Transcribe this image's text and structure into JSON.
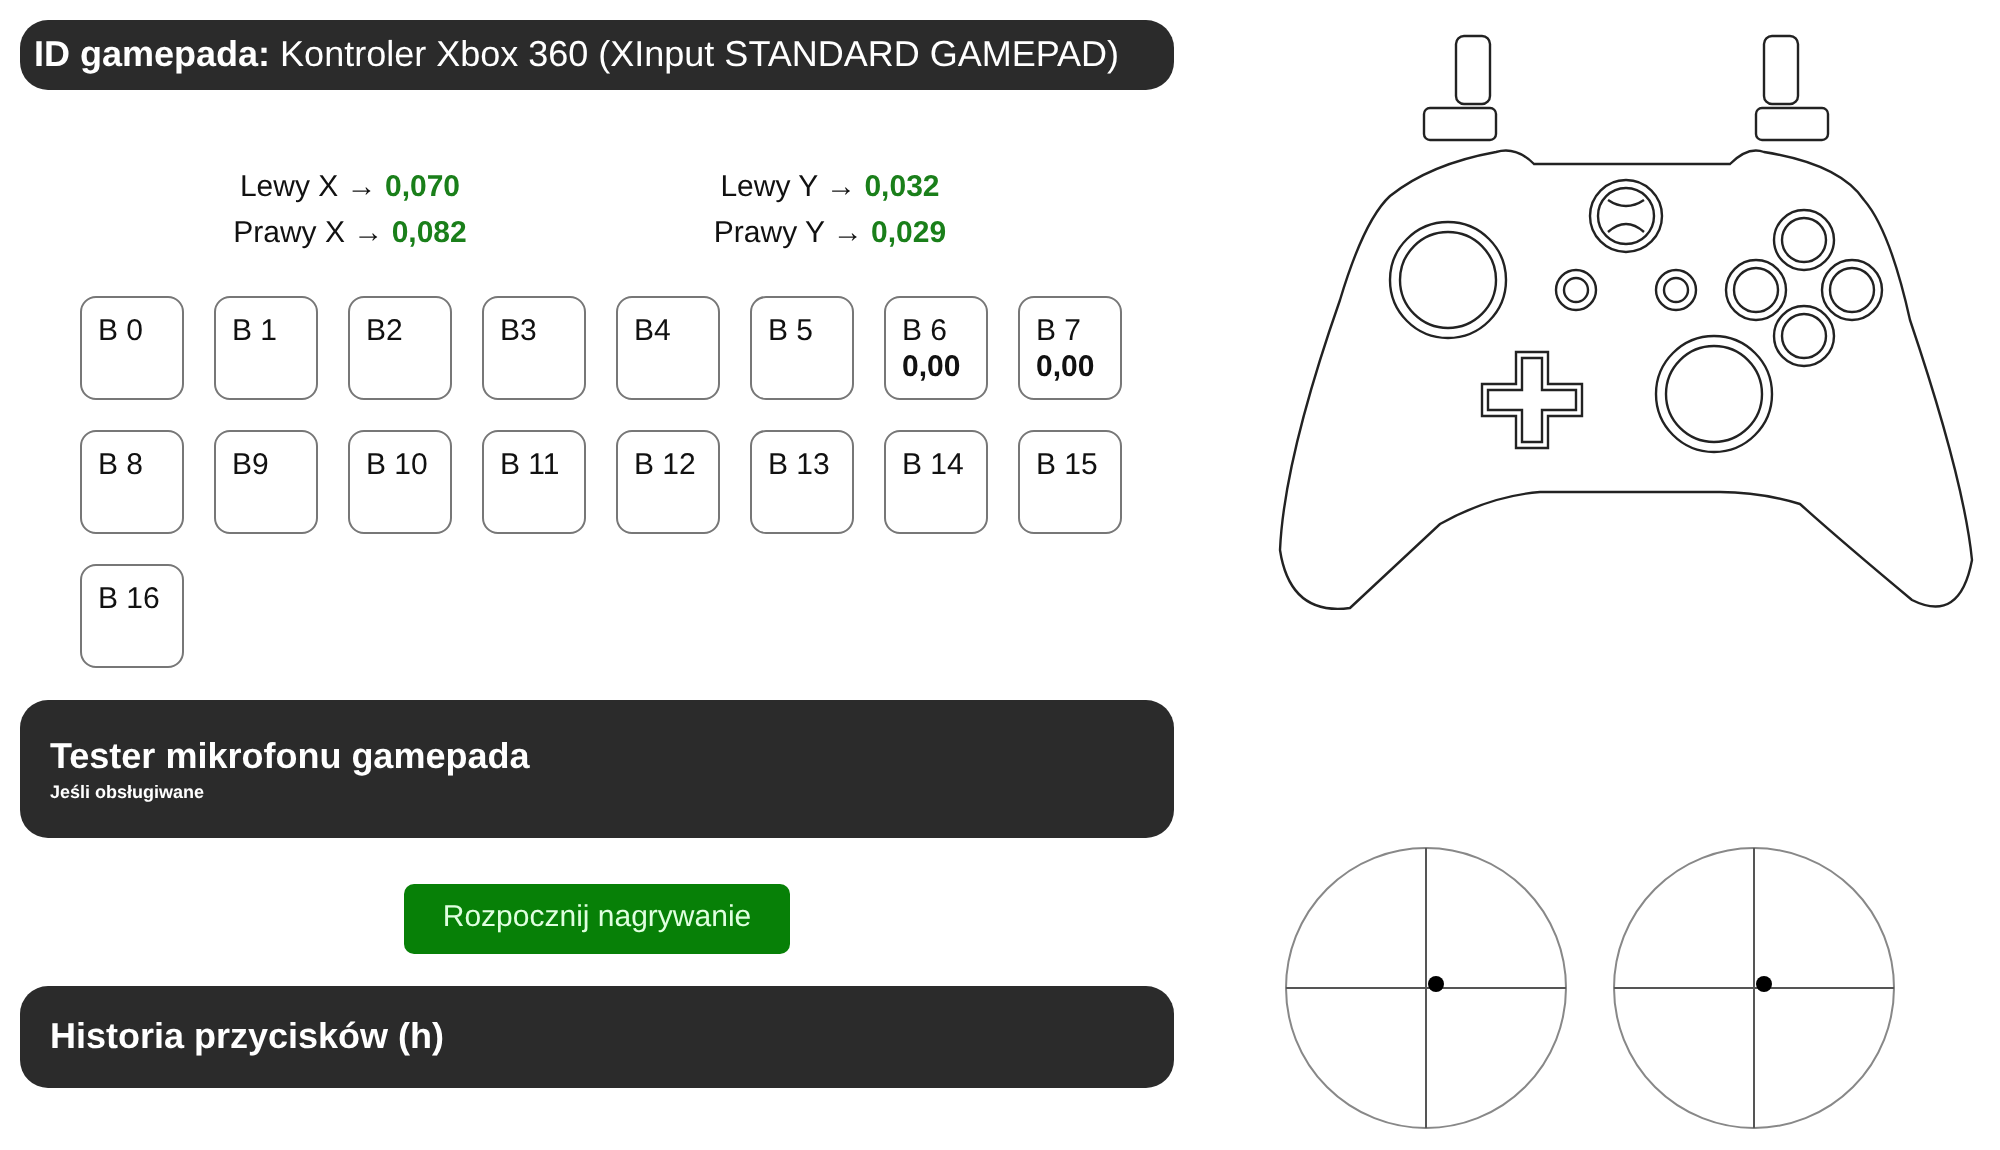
{
  "gamepad_id": {
    "label": "ID gamepada:",
    "value": "Kontroler Xbox 360 (XInput STANDARD GAMEPAD)"
  },
  "axes": [
    {
      "label": "Lewy X →",
      "value": "0,070"
    },
    {
      "label": "Lewy Y →",
      "value": "0,032"
    },
    {
      "label": "Prawy X →",
      "value": "0,082"
    },
    {
      "label": "Prawy Y →",
      "value": "0,029"
    }
  ],
  "buttons": [
    {
      "label": "B 0"
    },
    {
      "label": "B 1"
    },
    {
      "label": "B2"
    },
    {
      "label": "B3"
    },
    {
      "label": "B4"
    },
    {
      "label": "B 5"
    },
    {
      "label": "B 6",
      "value": "0,00"
    },
    {
      "label": "B 7",
      "value": "0,00"
    },
    {
      "label": "B 8"
    },
    {
      "label": "B9"
    },
    {
      "label": "B 10"
    },
    {
      "label": "B 11"
    },
    {
      "label": "B 12"
    },
    {
      "label": "B 13"
    },
    {
      "label": "B 14"
    },
    {
      "label": "B 15"
    },
    {
      "label": "B 16"
    }
  ],
  "microphone_panel": {
    "title": "Tester mikrofonu gamepada",
    "subtitle": "Jeśli obsługiwane"
  },
  "record_button": "Rozpocznij nagrywanie",
  "history_panel": {
    "title": "Historia przycisków (h)"
  }
}
